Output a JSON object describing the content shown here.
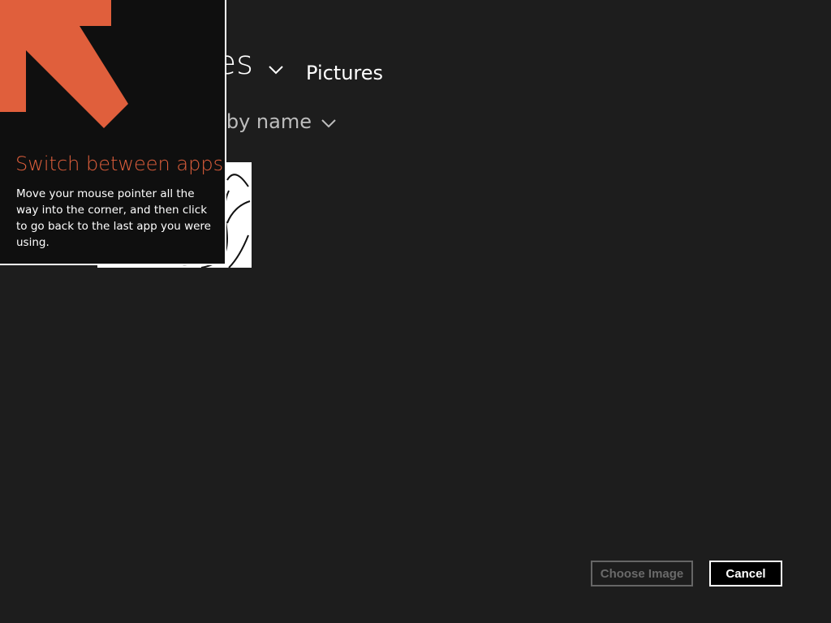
{
  "header": {
    "title_partial": "es",
    "location": "Pictures"
  },
  "sort": {
    "label_partial": "by name"
  },
  "tip": {
    "title": "Switch between apps",
    "body": "Move your mouse pointer all the way into the corner, and then click to go back to the last app you were using."
  },
  "buttons": {
    "choose_label": "Choose Image",
    "choose_enabled": false,
    "cancel_label": "Cancel"
  },
  "colors": {
    "background": "#1d1d1d",
    "tip_accent": "#e05f3c",
    "tip_background": "#0f0f0f"
  },
  "icons": {
    "header_dropdown": "chevron-down-icon",
    "sort_dropdown": "chevron-down-icon",
    "tip_arrow": "arrow-up-left-icon"
  }
}
